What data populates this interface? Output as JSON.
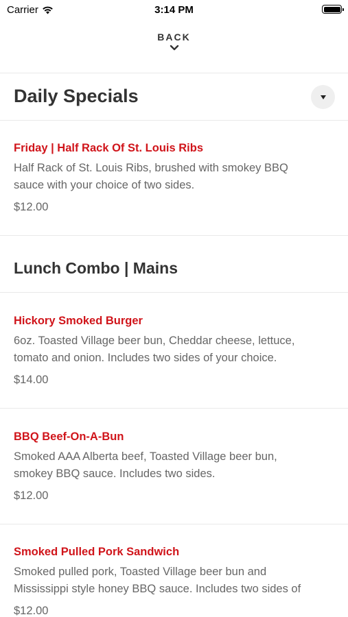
{
  "status_bar": {
    "carrier": "Carrier",
    "time": "3:14 PM"
  },
  "nav": {
    "back_label": "BACK"
  },
  "sections": {
    "daily_specials": {
      "title": "Daily Specials",
      "items": [
        {
          "name": "Friday | Half Rack Of St. Louis Ribs",
          "desc_line1": "Half Rack of St. Louis Ribs, brushed with smokey BBQ",
          "desc_line2": "sauce with your choice of two sides.",
          "price": "$12.00"
        }
      ]
    },
    "lunch_combo": {
      "title": "Lunch Combo | Mains",
      "items": [
        {
          "name": "Hickory Smoked Burger",
          "desc_line1": "6oz. Toasted Village beer bun, Cheddar cheese, lettuce,",
          "desc_line2": "tomato and onion. Includes two sides of your choice.",
          "price": "$14.00"
        },
        {
          "name": "BBQ Beef-On-A-Bun",
          "desc_line1": "Smoked AAA Alberta beef, Toasted Village beer bun,",
          "desc_line2": "smokey BBQ sauce. Includes two sides.",
          "price": "$12.00"
        },
        {
          "name": "Smoked Pulled Pork Sandwich",
          "desc_line1": "Smoked pulled pork, Toasted Village beer bun and",
          "desc_line2": "Mississippi style honey BBQ sauce. Includes two sides of",
          "price": "$12.00"
        }
      ]
    }
  },
  "colors": {
    "accent": "#d0141a",
    "text": "#333333",
    "muted": "#666666",
    "divider": "#e9e9e9"
  },
  "icons": {
    "signal": "wifi-icon",
    "battery": "battery-icon",
    "back": "chevron-down-icon",
    "dropdown": "caret-down-icon"
  }
}
